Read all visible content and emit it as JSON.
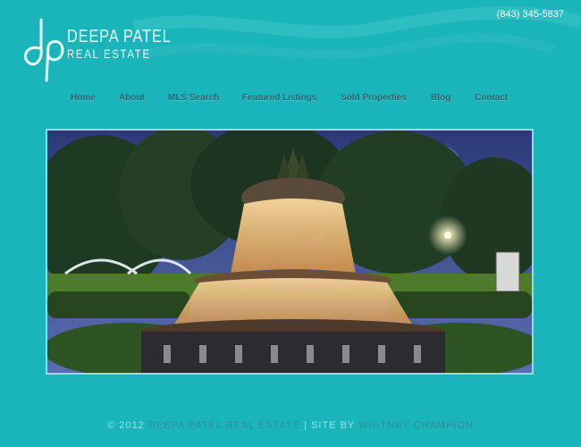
{
  "header": {
    "logo_monogram": "dp",
    "logo_name": "DEEPA PATEL",
    "logo_subtitle": "REAL ESTATE",
    "phone": "(843) 345-5837"
  },
  "nav": {
    "items": [
      "Home",
      "About",
      "MLS Search",
      "Featured Listings",
      "Sold Properties",
      "Blog",
      "Contact"
    ]
  },
  "hero": {
    "image_subject": "pineapple-fountain-night-photo"
  },
  "footer": {
    "copyright_symbol": "©",
    "year": "2012",
    "owner": "DEEPA PATEL REAL ESTATE",
    "separator": "|",
    "site_by_label": "SITE BY",
    "designer": "WHITNEY CHAMPION"
  },
  "colors": {
    "background": "#1ab5bb",
    "nav_text": "#35606a",
    "hero_border": "#7ee6ea",
    "footer_text": "#8ee7ea",
    "footer_highlight": "#2e8f99"
  }
}
